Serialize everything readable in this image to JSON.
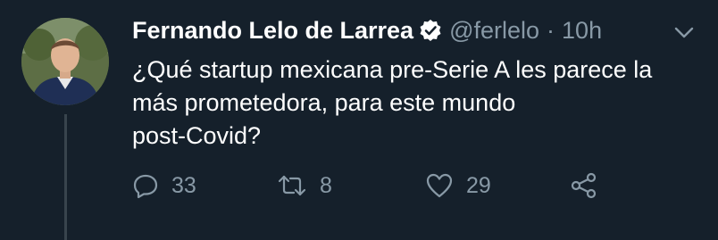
{
  "tweet": {
    "author_name": "Fernando Lelo de Larrea",
    "handle": "@ferlelo",
    "separator": "·",
    "time": "10h",
    "lines": [
      "¿Qué startup mexicana pre-Serie A les parece la",
      "más prometedora, para este mundo",
      "post-Covid?"
    ],
    "actions": {
      "reply_count": "33",
      "retweet_count": "8",
      "like_count": "29"
    }
  },
  "icons": {
    "verified": "verified-badge-icon",
    "menu": "chevron-down-icon",
    "reply": "reply-icon",
    "retweet": "retweet-icon",
    "like": "heart-icon",
    "share": "share-icon"
  },
  "colors": {
    "background": "#15202b",
    "primary_text": "#ffffff",
    "secondary_text": "#8899a6",
    "thread_line": "#38444d"
  }
}
